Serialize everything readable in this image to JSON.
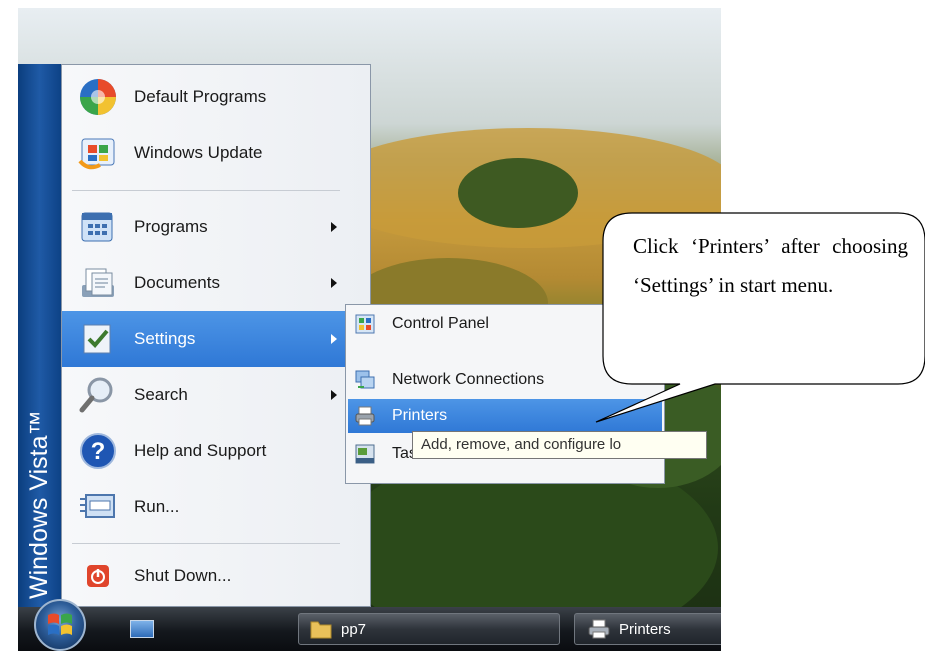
{
  "sidebar": {
    "brand": "Windows Vista™"
  },
  "start_menu": {
    "items": [
      {
        "label": "Default Programs",
        "icon": "default-programs-icon",
        "has_submenu": false
      },
      {
        "label": "Windows Update",
        "icon": "windows-update-icon",
        "has_submenu": false
      },
      {
        "label": "Programs",
        "icon": "programs-icon",
        "has_submenu": true
      },
      {
        "label": "Documents",
        "icon": "documents-icon",
        "has_submenu": true
      },
      {
        "label": "Settings",
        "icon": "settings-icon",
        "has_submenu": true,
        "selected": true
      },
      {
        "label": "Search",
        "icon": "search-icon",
        "has_submenu": true
      },
      {
        "label": "Help and Support",
        "icon": "help-icon",
        "has_submenu": false
      },
      {
        "label": "Run...",
        "icon": "run-icon",
        "has_submenu": false
      },
      {
        "label": "Shut Down...",
        "icon": "shutdown-icon",
        "has_submenu": false
      }
    ]
  },
  "settings_submenu": {
    "items": [
      {
        "label": "Control Panel",
        "icon": "control-panel-icon"
      },
      {
        "label": "Network Connections",
        "icon": "network-connections-icon"
      },
      {
        "label": "Printers",
        "icon": "printers-icon",
        "selected": true
      },
      {
        "label": "Task",
        "icon": "taskbar-icon"
      }
    ]
  },
  "tooltip": {
    "text": "Add, remove, and configure lo"
  },
  "taskbar": {
    "buttons": [
      {
        "label": "pp7",
        "icon": "folder-icon"
      },
      {
        "label": "Printers",
        "icon": "printers-icon"
      }
    ]
  },
  "callout": {
    "text": "Click ‘Printers’ after choosing ‘Settings’ in start menu."
  },
  "colors": {
    "selection": "#3a82dc",
    "sidebar": "#1a519b",
    "taskbar": "#14181d"
  }
}
